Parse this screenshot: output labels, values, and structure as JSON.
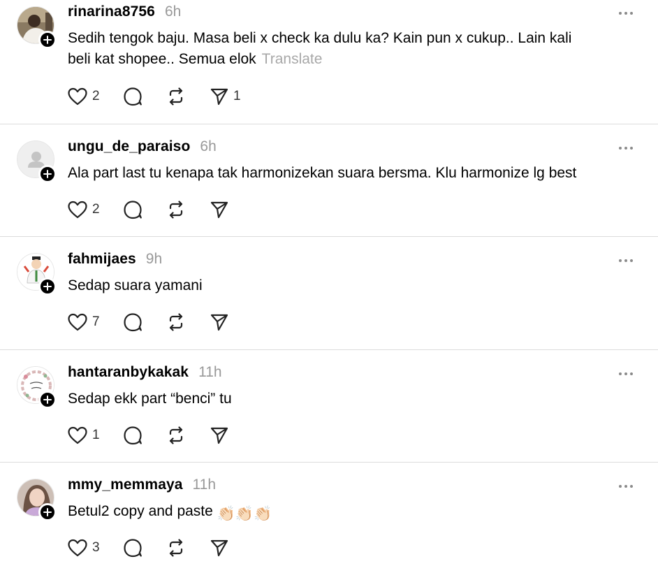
{
  "posts": [
    {
      "username": "rinarina8756",
      "time": "6h",
      "text_line1": "Sedih tengok baju. Masa beli x check ka dulu ka? Kain pun x cukup.. Lain kali",
      "text_line2": "beli kat shopee.. Semua elok",
      "translate": "Translate",
      "likes": "2",
      "reposts": "",
      "shares": "1"
    },
    {
      "username": "ungu_de_paraiso",
      "time": "6h",
      "text_line1": "Ala part last tu kenapa tak harmonizekan suara bersma. Klu harmonize lg best",
      "likes": "2",
      "shares": ""
    },
    {
      "username": "fahmijaes",
      "time": "9h",
      "text_line1": "Sedap suara yamani",
      "likes": "7",
      "shares": ""
    },
    {
      "username": "hantaranbykakak",
      "time": "11h",
      "text_line1": "Sedap ekk part “benci” tu",
      "likes": "1",
      "shares": ""
    },
    {
      "username": "mmy_memmaya",
      "time": "11h",
      "text_line1": "Betul2 copy and paste",
      "emoji": "👏🏻👏🏻👏🏻",
      "likes": "3",
      "shares": ""
    }
  ],
  "icons": {
    "like": "heart-icon",
    "reply": "comment-bubble-icon",
    "repost": "repost-icon",
    "share": "send-icon",
    "more": "more-dots-icon",
    "follow": "plus-icon"
  },
  "colors": {
    "timestamp": "#999999",
    "divider": "#dcdcdc",
    "badge": "#000000"
  }
}
